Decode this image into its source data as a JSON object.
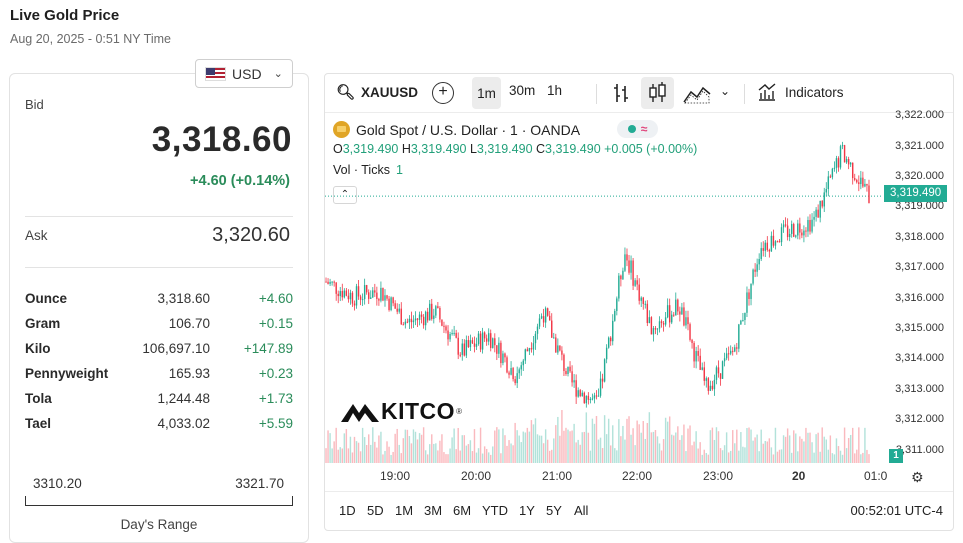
{
  "header": {
    "title": "Live Gold Price",
    "subtitle": "Aug 20, 2025 - 0:51 NY Time"
  },
  "currency": {
    "selected": "USD",
    "icon": "us-flag-icon"
  },
  "quote": {
    "bid_label": "Bid",
    "bid": "3,318.60",
    "bid_change": "+4.60 (+0.14%)",
    "ask_label": "Ask",
    "ask": "3,320.60"
  },
  "units": [
    {
      "name": "Ounce",
      "price": "3,318.60",
      "change": "+4.60"
    },
    {
      "name": "Gram",
      "price": "106.70",
      "change": "+0.15"
    },
    {
      "name": "Kilo",
      "price": "106,697.10",
      "change": "+147.89"
    },
    {
      "name": "Pennyweight",
      "price": "165.93",
      "change": "+0.23"
    },
    {
      "name": "Tola",
      "price": "1,244.48",
      "change": "+1.73"
    },
    {
      "name": "Tael",
      "price": "4,033.02",
      "change": "+5.59"
    }
  ],
  "day_range": {
    "low": "3310.20",
    "high": "3321.70",
    "label": "Day's Range"
  },
  "chart": {
    "symbol": "XAUUSD",
    "timeframes": [
      "1m",
      "30m",
      "1h"
    ],
    "active_timeframe": "1m",
    "indicators_label": "Indicators",
    "legend": "Gold Spot / U.S. Dollar · 1 · OANDA",
    "ohlc": {
      "o_label": "O",
      "o": "3,319.490",
      "h_label": "H",
      "h": "3,319.490",
      "l_label": "L",
      "l": "3,319.490",
      "c_label": "C",
      "c": "3,319.490",
      "change": "+0.005 (+0.00%)"
    },
    "vol_label": "Vol · Ticks",
    "vol_value": "1",
    "last_price_tag": "3,319.490",
    "volume_tag": "1",
    "y_ticks": [
      "3,322.000",
      "3,321.000",
      "3,320.000",
      "3,319.000",
      "3,318.000",
      "3,317.000",
      "3,316.000",
      "3,315.000",
      "3,314.000",
      "3,313.000",
      "3,312.000",
      "3,311.000"
    ],
    "x_ticks": [
      "19:00",
      "20:00",
      "21:00",
      "22:00",
      "23:00",
      "20",
      "01:0"
    ],
    "range_buttons": [
      "1D",
      "5D",
      "1M",
      "3M",
      "6M",
      "YTD",
      "1Y",
      "5Y",
      "All"
    ],
    "clock": "00:52:01 UTC-4",
    "watermark": "KITCO",
    "up_color": "#22ab94",
    "down_color": "#f23645"
  },
  "chart_data": {
    "type": "line",
    "title": "Gold Spot / U.S. Dollar · 1 · OANDA",
    "x": [
      "18:20",
      "18:40",
      "19:00",
      "19:20",
      "19:40",
      "20:00",
      "20:20",
      "20:40",
      "21:00",
      "21:20",
      "21:40",
      "22:00",
      "22:20",
      "22:40",
      "23:00",
      "23:20",
      "23:40",
      "00:00",
      "00:20",
      "00:40",
      "00:51"
    ],
    "values": [
      3316.6,
      3316.1,
      3316.3,
      3315.2,
      3315.6,
      3314.2,
      3314.8,
      3313.4,
      3315.6,
      3313.2,
      3312.4,
      3317.6,
      3315.0,
      3315.8,
      3313.0,
      3314.2,
      3317.8,
      3318.3,
      3318.7,
      3321.0,
      3319.49
    ],
    "ylim": [
      3310.6,
      3322.1
    ],
    "xlabel": "",
    "ylabel": ""
  }
}
